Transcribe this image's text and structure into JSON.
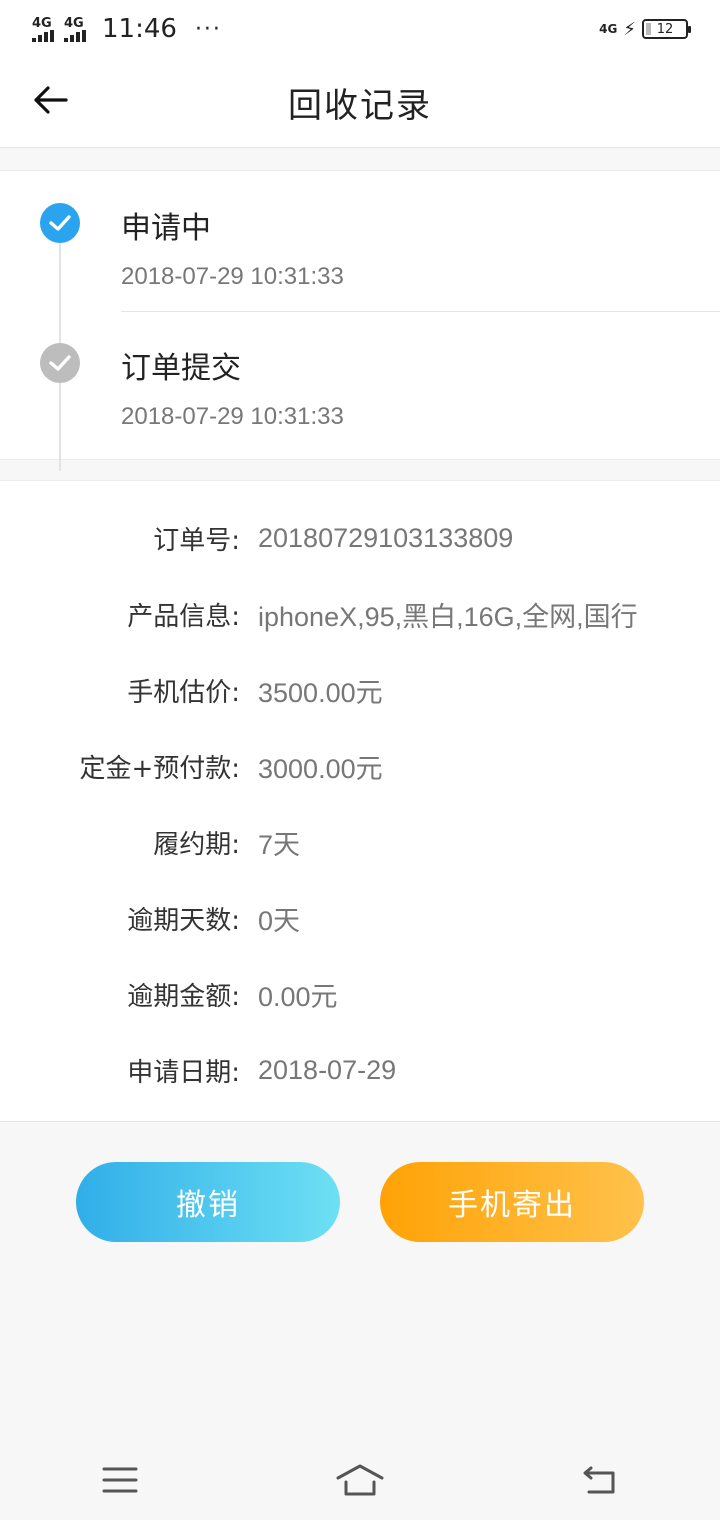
{
  "status_bar": {
    "network_1": "4G",
    "network_2": "4G",
    "time": "11:46",
    "more": "···",
    "network_right": "4G",
    "battery": "12"
  },
  "header": {
    "title": "回收记录",
    "back_icon": "arrow-left-icon"
  },
  "timeline": {
    "steps": [
      {
        "name": "申请中",
        "time": "2018-07-29 10:31:33",
        "state": "active",
        "color": "#2aa4ee"
      },
      {
        "name": "订单提交",
        "time": "2018-07-29 10:31:33",
        "state": "done",
        "color": "#bdbdbd"
      }
    ]
  },
  "details": {
    "rows": [
      {
        "label": "订单号:",
        "value": "20180729103133809"
      },
      {
        "label": "产品信息:",
        "value": "iphoneX,95,黑白,16G,全网,国行"
      },
      {
        "label": "手机估价:",
        "value": "3500.00元"
      },
      {
        "label": "定金+预付款:",
        "value": "3000.00元"
      },
      {
        "label": "履约期:",
        "value": "7天"
      },
      {
        "label": "逾期天数:",
        "value": "0天"
      },
      {
        "label": "逾期金额:",
        "value": "0.00元"
      },
      {
        "label": "申请日期:",
        "value": "2018-07-29"
      }
    ]
  },
  "actions": {
    "cancel_label": "撤销",
    "ship_label": "手机寄出",
    "cancel_color": "#30aee8",
    "ship_color": "#ffa206"
  },
  "navbar": {
    "icons": [
      "menu-icon",
      "home-icon",
      "back-icon"
    ]
  }
}
